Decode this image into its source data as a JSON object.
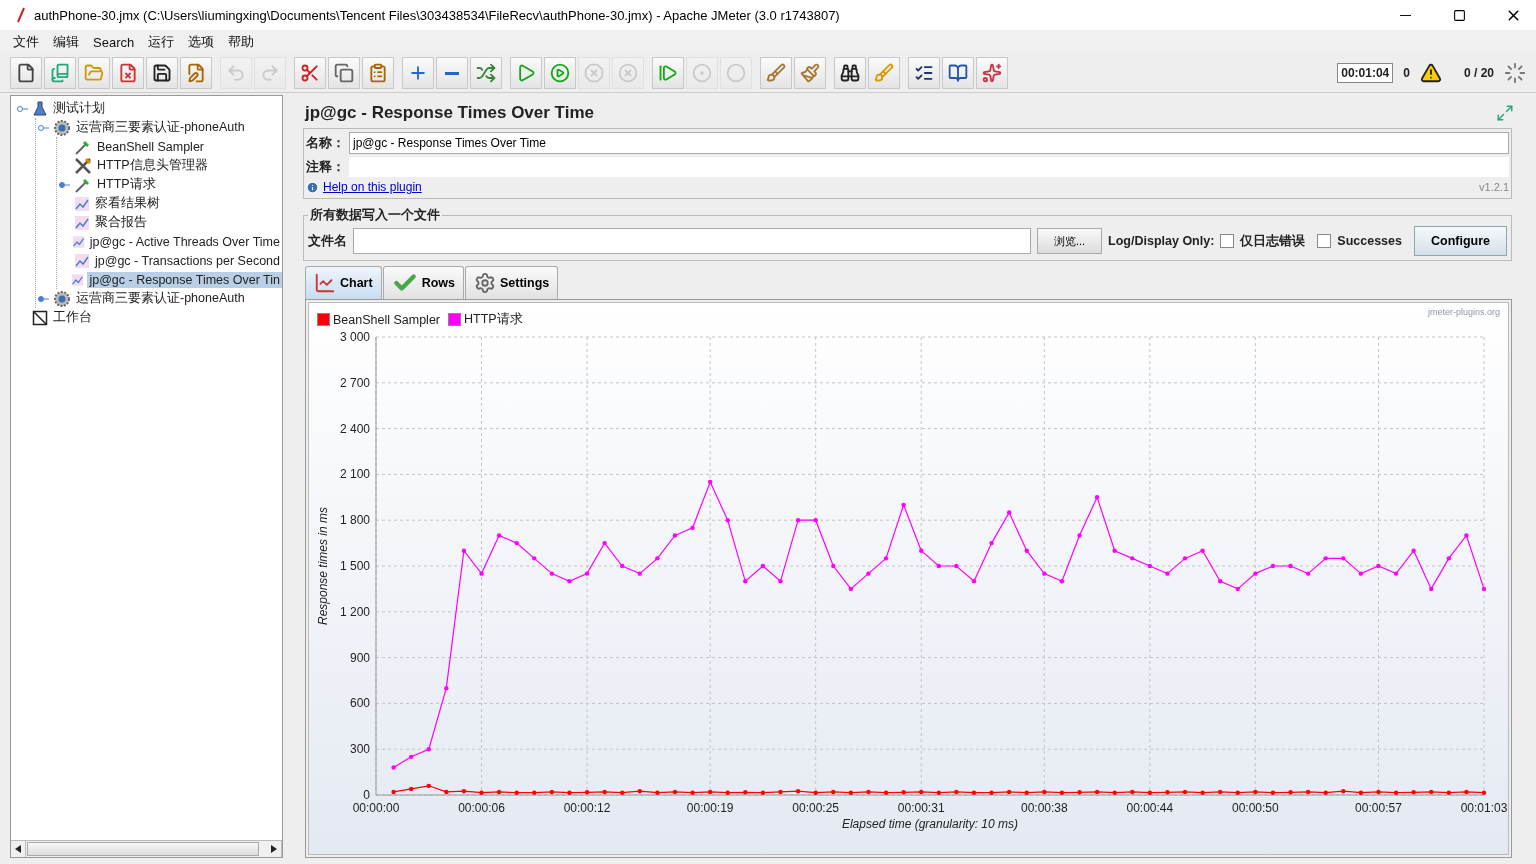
{
  "window": {
    "title": "authPhone-30.jmx (C:\\Users\\liumingxing\\Documents\\Tencent Files\\303438534\\FileRecv\\authPhone-30.jmx) - Apache JMeter (3.0 r1743807)"
  },
  "menu": [
    "文件",
    "编辑",
    "Search",
    "运行",
    "选项",
    "帮助"
  ],
  "toolbar": {
    "groups": [
      [
        {
          "disabled": false
        },
        {
          "disabled": false
        },
        {
          "disabled": false
        },
        {
          "disabled": false
        },
        {
          "disabled": false
        },
        {
          "disabled": false
        }
      ],
      [
        {
          "disabled": true
        },
        {
          "disabled": true
        }
      ],
      [
        {
          "disabled": false
        },
        {
          "disabled": false
        },
        {
          "disabled": false
        }
      ],
      [
        {
          "disabled": false
        },
        {
          "disabled": false
        },
        {
          "disabled": false
        }
      ],
      [
        {
          "disabled": false
        },
        {
          "disabled": false
        },
        {
          "disabled": true
        },
        {
          "disabled": true
        }
      ],
      [
        {
          "disabled": false
        },
        {
          "disabled": true
        },
        {
          "disabled": true
        }
      ],
      [
        {
          "disabled": false
        },
        {
          "disabled": false
        }
      ],
      [
        {
          "disabled": false
        },
        {
          "disabled": false
        }
      ],
      [
        {
          "disabled": false
        },
        {
          "disabled": false
        },
        {
          "disabled": false
        }
      ]
    ],
    "timer": "00:01:04",
    "warnings": "0",
    "threads": "0 / 20"
  },
  "tree": [
    {
      "label": "测试计划",
      "kind": "plan",
      "selected": false,
      "expanded": true,
      "children": [
        {
          "label": "运营商三要素认证-phoneAuth",
          "kind": "thread-group",
          "selected": false,
          "expanded": true,
          "children": [
            {
              "label": "BeanShell Sampler",
              "kind": "sampler",
              "selected": false
            },
            {
              "label": "HTTP信息头管理器",
              "kind": "config",
              "selected": false
            },
            {
              "label": "HTTP请求",
              "kind": "sampler",
              "selected": false,
              "expanded": false
            },
            {
              "label": "察看结果树",
              "kind": "listener",
              "selected": false
            },
            {
              "label": "聚合报告",
              "kind": "listener",
              "selected": false
            },
            {
              "label": "jp@gc - Active Threads Over Time",
              "kind": "listener",
              "selected": false
            },
            {
              "label": "jp@gc - Transactions per Second",
              "kind": "listener",
              "selected": false
            },
            {
              "label": "jp@gc - Response Times Over Tin",
              "kind": "listener",
              "selected": true
            }
          ]
        },
        {
          "label": "运营商三要素认证-phoneAuth",
          "kind": "thread-group",
          "selected": false,
          "expanded": false
        }
      ]
    },
    {
      "label": "工作台",
      "kind": "workbench",
      "selected": false
    }
  ],
  "panel": {
    "title": "jp@gc - Response Times Over Time",
    "name_label": "名称：",
    "name_value": "jp@gc - Response Times Over Time",
    "comment_label": "注释：",
    "help_link": "Help on this plugin",
    "version": "v1.2.1"
  },
  "file_section": {
    "legend": "所有数据写入一个文件",
    "file_label": "文件名",
    "browse": "浏览...",
    "log_label": "Log/Display Only:",
    "options": [
      {
        "label": "仅日志错误",
        "checked": false
      },
      {
        "label": "Successes",
        "checked": false
      }
    ],
    "configure": "Configure"
  },
  "tabs": [
    {
      "label": "Chart",
      "selected": true
    },
    {
      "label": "Rows",
      "selected": false
    },
    {
      "label": "Settings",
      "selected": false
    }
  ],
  "chart_credit": "jmeter-plugins.org",
  "chart_data": {
    "type": "line",
    "xlabel": "Elapsed time (granularity: 10 ms)",
    "ylabel": "Response times in ms",
    "x": [
      1,
      2,
      3,
      4,
      5,
      6,
      7,
      8,
      9,
      10,
      11,
      12,
      13,
      14,
      15,
      16,
      17,
      18,
      19,
      20,
      21,
      22,
      23,
      24,
      25,
      26,
      27,
      28,
      29,
      30,
      31,
      32,
      33,
      34,
      35,
      36,
      37,
      38,
      39,
      40,
      41,
      42,
      43,
      44,
      45,
      46,
      47,
      48,
      49,
      50,
      51,
      52,
      53,
      54,
      55,
      56,
      57,
      58,
      59,
      60,
      61,
      62,
      63
    ],
    "series": [
      {
        "name": "BeanShell Sampler",
        "color": "#ff0000",
        "values": [
          20,
          40,
          60,
          20,
          25,
          15,
          20,
          15,
          15,
          20,
          15,
          18,
          20,
          15,
          25,
          15,
          20,
          15,
          20,
          15,
          18,
          15,
          20,
          25,
          15,
          20,
          15,
          20,
          15,
          18,
          20,
          15,
          20,
          15,
          15,
          20,
          15,
          20,
          15,
          18,
          20,
          15,
          20,
          15,
          18,
          20,
          15,
          20,
          15,
          20,
          15,
          18,
          20,
          15,
          25,
          15,
          20,
          15,
          18,
          20,
          15,
          20,
          15
        ]
      },
      {
        "name": "HTTP请求",
        "color": "#ff00ff",
        "values": [
          180,
          250,
          300,
          700,
          1600,
          1450,
          1700,
          1650,
          1550,
          1450,
          1400,
          1450,
          1650,
          1500,
          1450,
          1550,
          1700,
          1750,
          2050,
          1800,
          1400,
          1500,
          1400,
          1800,
          1800,
          1500,
          1350,
          1450,
          1550,
          1900,
          1600,
          1500,
          1500,
          1400,
          1650,
          1850,
          1600,
          1450,
          1400,
          1700,
          1950,
          1600,
          1550,
          1500,
          1450,
          1550,
          1600,
          1400,
          1350,
          1450,
          1500,
          1500,
          1450,
          1550,
          1550,
          1450,
          1500,
          1450,
          1600,
          1350,
          1550,
          1700,
          1350
        ]
      }
    ],
    "xlim": [
      0,
      63
    ],
    "ylim": [
      0,
      3000
    ],
    "grid": true,
    "legend": true,
    "xticks": [
      {
        "value": 0,
        "label": "00:00:00"
      },
      {
        "value": 6,
        "label": "00:00:06"
      },
      {
        "value": 12,
        "label": "00:00:12"
      },
      {
        "value": 19,
        "label": "00:00:19"
      },
      {
        "value": 25,
        "label": "00:00:25"
      },
      {
        "value": 31,
        "label": "00:00:31"
      },
      {
        "value": 38,
        "label": "00:00:38"
      },
      {
        "value": 44,
        "label": "00:00:44"
      },
      {
        "value": 50,
        "label": "00:00:50"
      },
      {
        "value": 57,
        "label": "00:00:57"
      },
      {
        "value": 63,
        "label": "00:01:03"
      }
    ],
    "yticks": [
      {
        "value": 0,
        "label": "0"
      },
      {
        "value": 300,
        "label": "300"
      },
      {
        "value": 600,
        "label": "600"
      },
      {
        "value": 900,
        "label": "900"
      },
      {
        "value": 1200,
        "label": "1 200"
      },
      {
        "value": 1500,
        "label": "1 500"
      },
      {
        "value": 1800,
        "label": "1 800"
      },
      {
        "value": 2100,
        "label": "2 100"
      },
      {
        "value": 2400,
        "label": "2 400"
      },
      {
        "value": 2700,
        "label": "2 700"
      },
      {
        "value": 3000,
        "label": "3 000"
      }
    ]
  }
}
